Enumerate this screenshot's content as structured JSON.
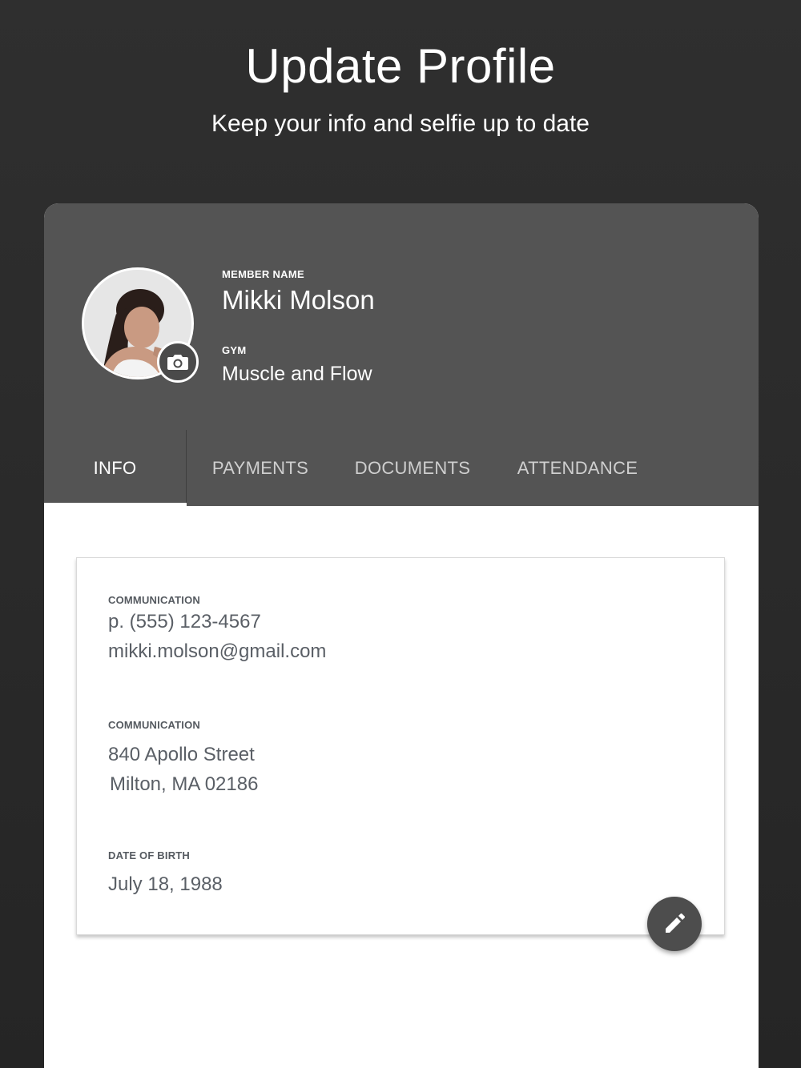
{
  "header": {
    "title": "Update Profile",
    "subtitle": "Keep your info and selfie up to date"
  },
  "profile": {
    "member_name_label": "MEMBER NAME",
    "member_name": "Mikki Molson",
    "gym_label": "GYM",
    "gym_name": "Muscle and Flow",
    "camera_icon": "camera-icon"
  },
  "tabs": [
    {
      "label": "INFO",
      "active": true
    },
    {
      "label": "PAYMENTS",
      "active": false
    },
    {
      "label": "DOCUMENTS",
      "active": false
    },
    {
      "label": "ATTENDANCE",
      "active": false
    }
  ],
  "info": {
    "communication": {
      "label": "COMMUNICATION",
      "phone": "p. (555) 123-4567",
      "email": "mikki.molson@gmail.com"
    },
    "address": {
      "label": "COMMUNICATION",
      "line1": "840 Apollo Street",
      "line2": "Milton, MA 02186"
    },
    "dob": {
      "label": "DATE OF BIRTH",
      "value": "July 18, 1988"
    },
    "edit_icon": "pencil-icon"
  },
  "colors": {
    "background": "#2b2b2b",
    "card_header": "#545454",
    "fab": "#4d4d4d",
    "text_muted": "#5a5f66"
  }
}
